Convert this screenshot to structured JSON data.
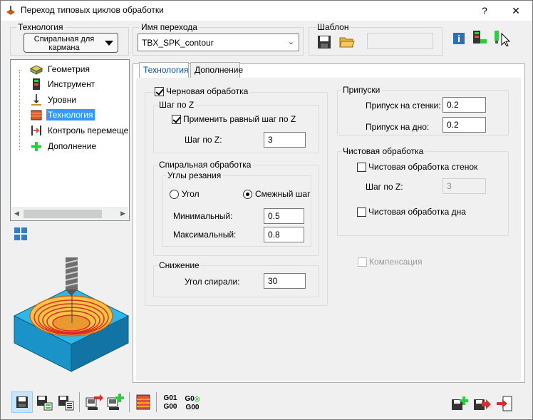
{
  "window": {
    "title": "Переход типовых циклов обработки",
    "help_label": "?",
    "close_label": "✕"
  },
  "header": {
    "technology_group": "Технология",
    "technology_value": "Спиральная для кармана",
    "transition_group": "Имя перехода",
    "transition_value": "TBX_SPK_contour",
    "template_group": "Шаблон",
    "template_value": ""
  },
  "tree": {
    "items": [
      {
        "label": "Геометрия",
        "icon": "geometry-icon"
      },
      {
        "label": "Инструмент",
        "icon": "tool-icon"
      },
      {
        "label": "Уровни",
        "icon": "levels-icon"
      },
      {
        "label": "Технология",
        "icon": "technology-icon",
        "selected": true
      },
      {
        "label": "Контроль перемеще",
        "icon": "motion-control-icon"
      },
      {
        "label": "Дополнение",
        "icon": "addition-icon"
      }
    ]
  },
  "tabs": [
    {
      "label": "Технология",
      "active": true
    },
    {
      "label": "Дополнение",
      "active": false
    }
  ],
  "form": {
    "rough_label": "Черновая обработка",
    "rough_checked": true,
    "step_z_group": "Шаг по Z",
    "equal_step_label": "Применить равный шаг по Z",
    "equal_step_checked": true,
    "step_z_label": "Шаг по Z:",
    "step_z_value": "3",
    "spiral_group": "Спиральная обработка",
    "angles_group": "Углы резания",
    "radio_angle_label": "Угол",
    "radio_adjacent_label": "Смежный шаг",
    "selected_radio": "Смежный шаг",
    "min_label": "Минимальный:",
    "min_value": "0.5",
    "max_label": "Максимальный:",
    "max_value": "0.8",
    "descent_group": "Снижение",
    "spiral_angle_label": "Угол спирали:",
    "spiral_angle_value": "30",
    "allowance_group": "Припуски",
    "wall_allowance_label": "Припуск на стенки:",
    "wall_allowance_value": "0.2",
    "floor_allowance_label": "Припуск на дно:",
    "floor_allowance_value": "0.2",
    "finish_group": "Чистовая обработка",
    "finish_walls_label": "Чистовая обработка стенок",
    "finish_walls_checked": false,
    "finish_step_label": "Шаг по Z:",
    "finish_step_value": "3",
    "finish_floor_label": "Чистовая обработка дна",
    "finish_floor_checked": false,
    "compensation_label": "Компенсация",
    "compensation_checked": false
  },
  "toolbar": {
    "g01_line1": "G01",
    "g01_line2": "G00",
    "g0_line1": "G0",
    "g0_line2": "G00"
  },
  "colors": {
    "selection": "#3399ff",
    "accent_blue": "#0050a0",
    "part_blue": "#29b6e8",
    "spiral_orange": "#f0a020"
  }
}
